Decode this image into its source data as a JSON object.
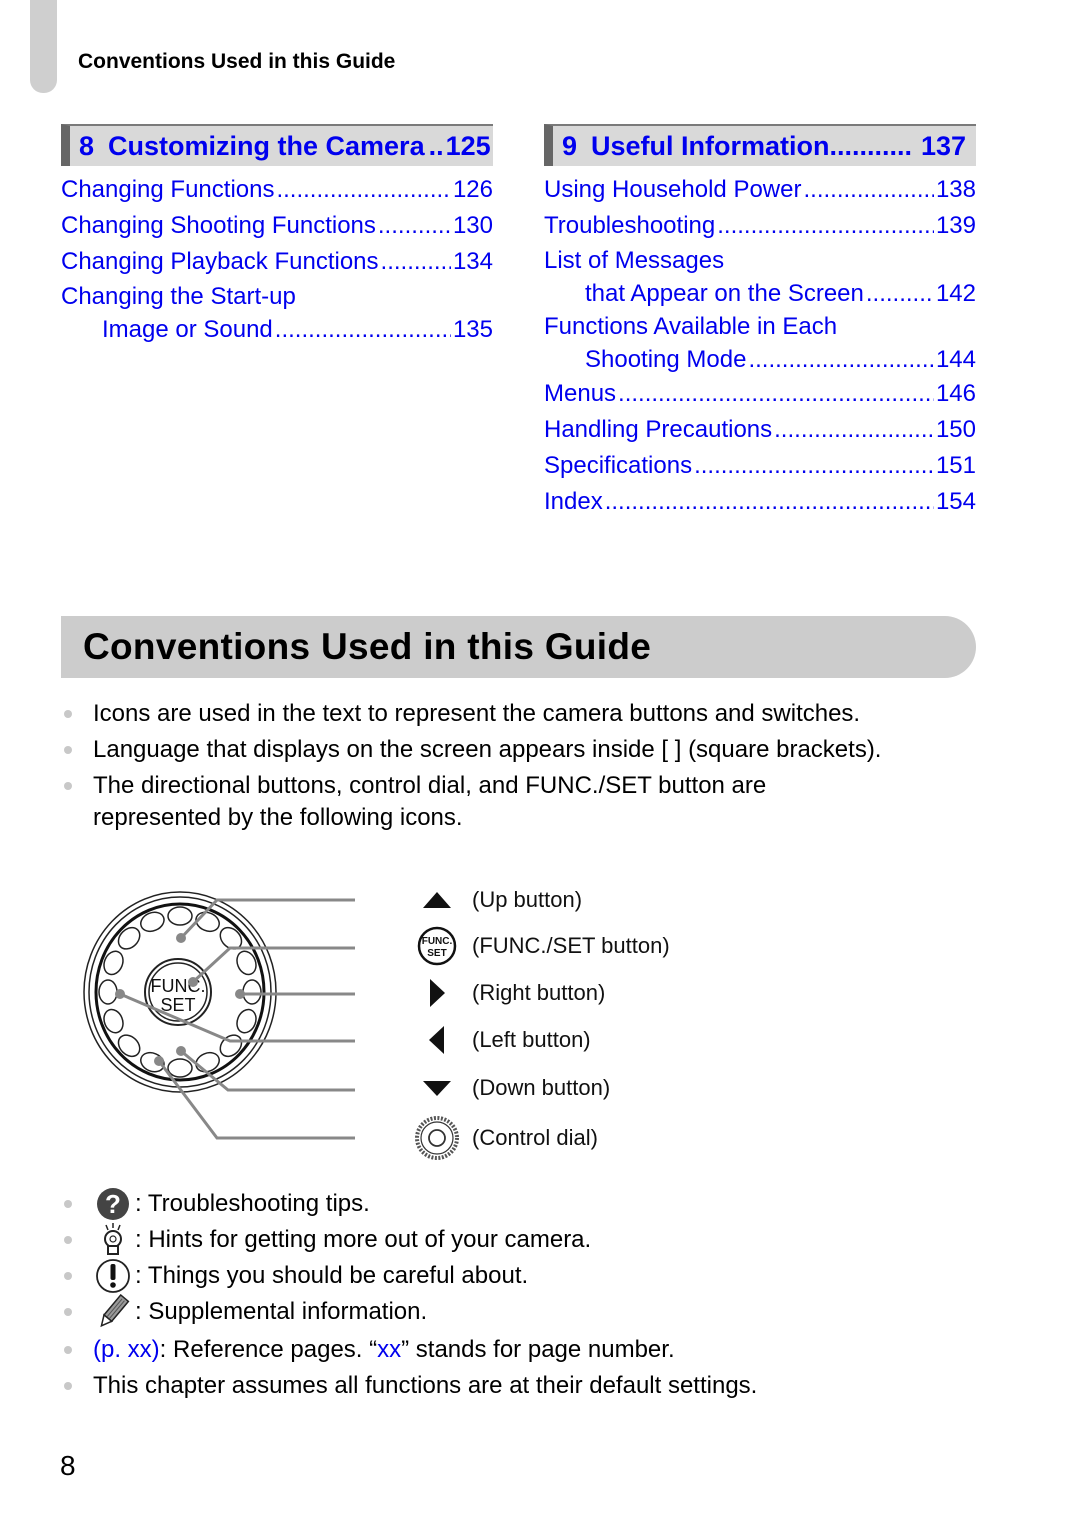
{
  "running_head": "Conventions Used in this Guide",
  "toc": {
    "left": {
      "chapter": {
        "number": "8",
        "title": "Customizing the Camera",
        "leader": "..",
        "page": "125"
      },
      "entries": [
        {
          "label": "Changing Functions",
          "page": "126"
        },
        {
          "label": "Changing Shooting Functions",
          "page": "130"
        },
        {
          "label": "Changing Playback Functions",
          "page": "134"
        },
        {
          "label_line1": "Changing the Start-up",
          "label_line2": "Image or Sound",
          "page": "135"
        }
      ]
    },
    "right": {
      "chapter": {
        "number": "9",
        "title": "Useful Information",
        "leader": "...........",
        "page": "137"
      },
      "entries": [
        {
          "label": "Using Household Power",
          "page": "138"
        },
        {
          "label": "Troubleshooting",
          "page": "139"
        },
        {
          "label_line1": "List of Messages",
          "label_line2": "that Appear on the Screen",
          "page": "142"
        },
        {
          "label_line1": "Functions Available in Each",
          "label_line2": "Shooting Mode",
          "page": "144"
        },
        {
          "label": "Menus",
          "page": "146"
        },
        {
          "label": "Handling Precautions",
          "page": "150"
        },
        {
          "label": "Specifications",
          "page": "151"
        },
        {
          "label": "Index",
          "page": "154"
        }
      ]
    }
  },
  "section_title": "Conventions Used in this Guide",
  "bullets": [
    "Icons are used in the text to represent the camera buttons and switches.",
    "Language that displays on the screen appears inside [ ] (square brackets).",
    "The directional buttons, control dial, and FUNC./SET button are represented by the following icons."
  ],
  "diagram": {
    "dial_label_top": "FUNC.",
    "dial_label_bottom": "SET",
    "legend": [
      {
        "icon": "up-triangle-icon",
        "label": "(Up button)"
      },
      {
        "icon": "func-set-icon",
        "label": "(FUNC./SET button)"
      },
      {
        "icon": "right-triangle-icon",
        "label": "(Right button)"
      },
      {
        "icon": "left-triangle-icon",
        "label": "(Left button)"
      },
      {
        "icon": "down-triangle-icon",
        "label": "(Down button)"
      },
      {
        "icon": "control-dial-icon",
        "label": "(Control dial)"
      }
    ]
  },
  "icon_bullets": [
    {
      "icon": "question-mark-icon",
      "text": ": Troubleshooting tips."
    },
    {
      "icon": "lightbulb-icon",
      "text": ": Hints for getting more out of your camera."
    },
    {
      "icon": "exclamation-icon",
      "text": ": Things you should be careful about."
    },
    {
      "icon": "pencil-icon",
      "text": ": Supplemental information."
    }
  ],
  "final_bullets": {
    "reference": {
      "link": "(p. xx)",
      "text_a": ": Reference pages. “",
      "xx": "xx",
      "text_b": "” stands for page number."
    },
    "default_settings": "This chapter assumes all functions are at their default settings."
  },
  "page_number": "8",
  "colors": {
    "link": "#0000ee",
    "bar": "#cccccc",
    "chapter_bar": "#d9d9d9"
  }
}
